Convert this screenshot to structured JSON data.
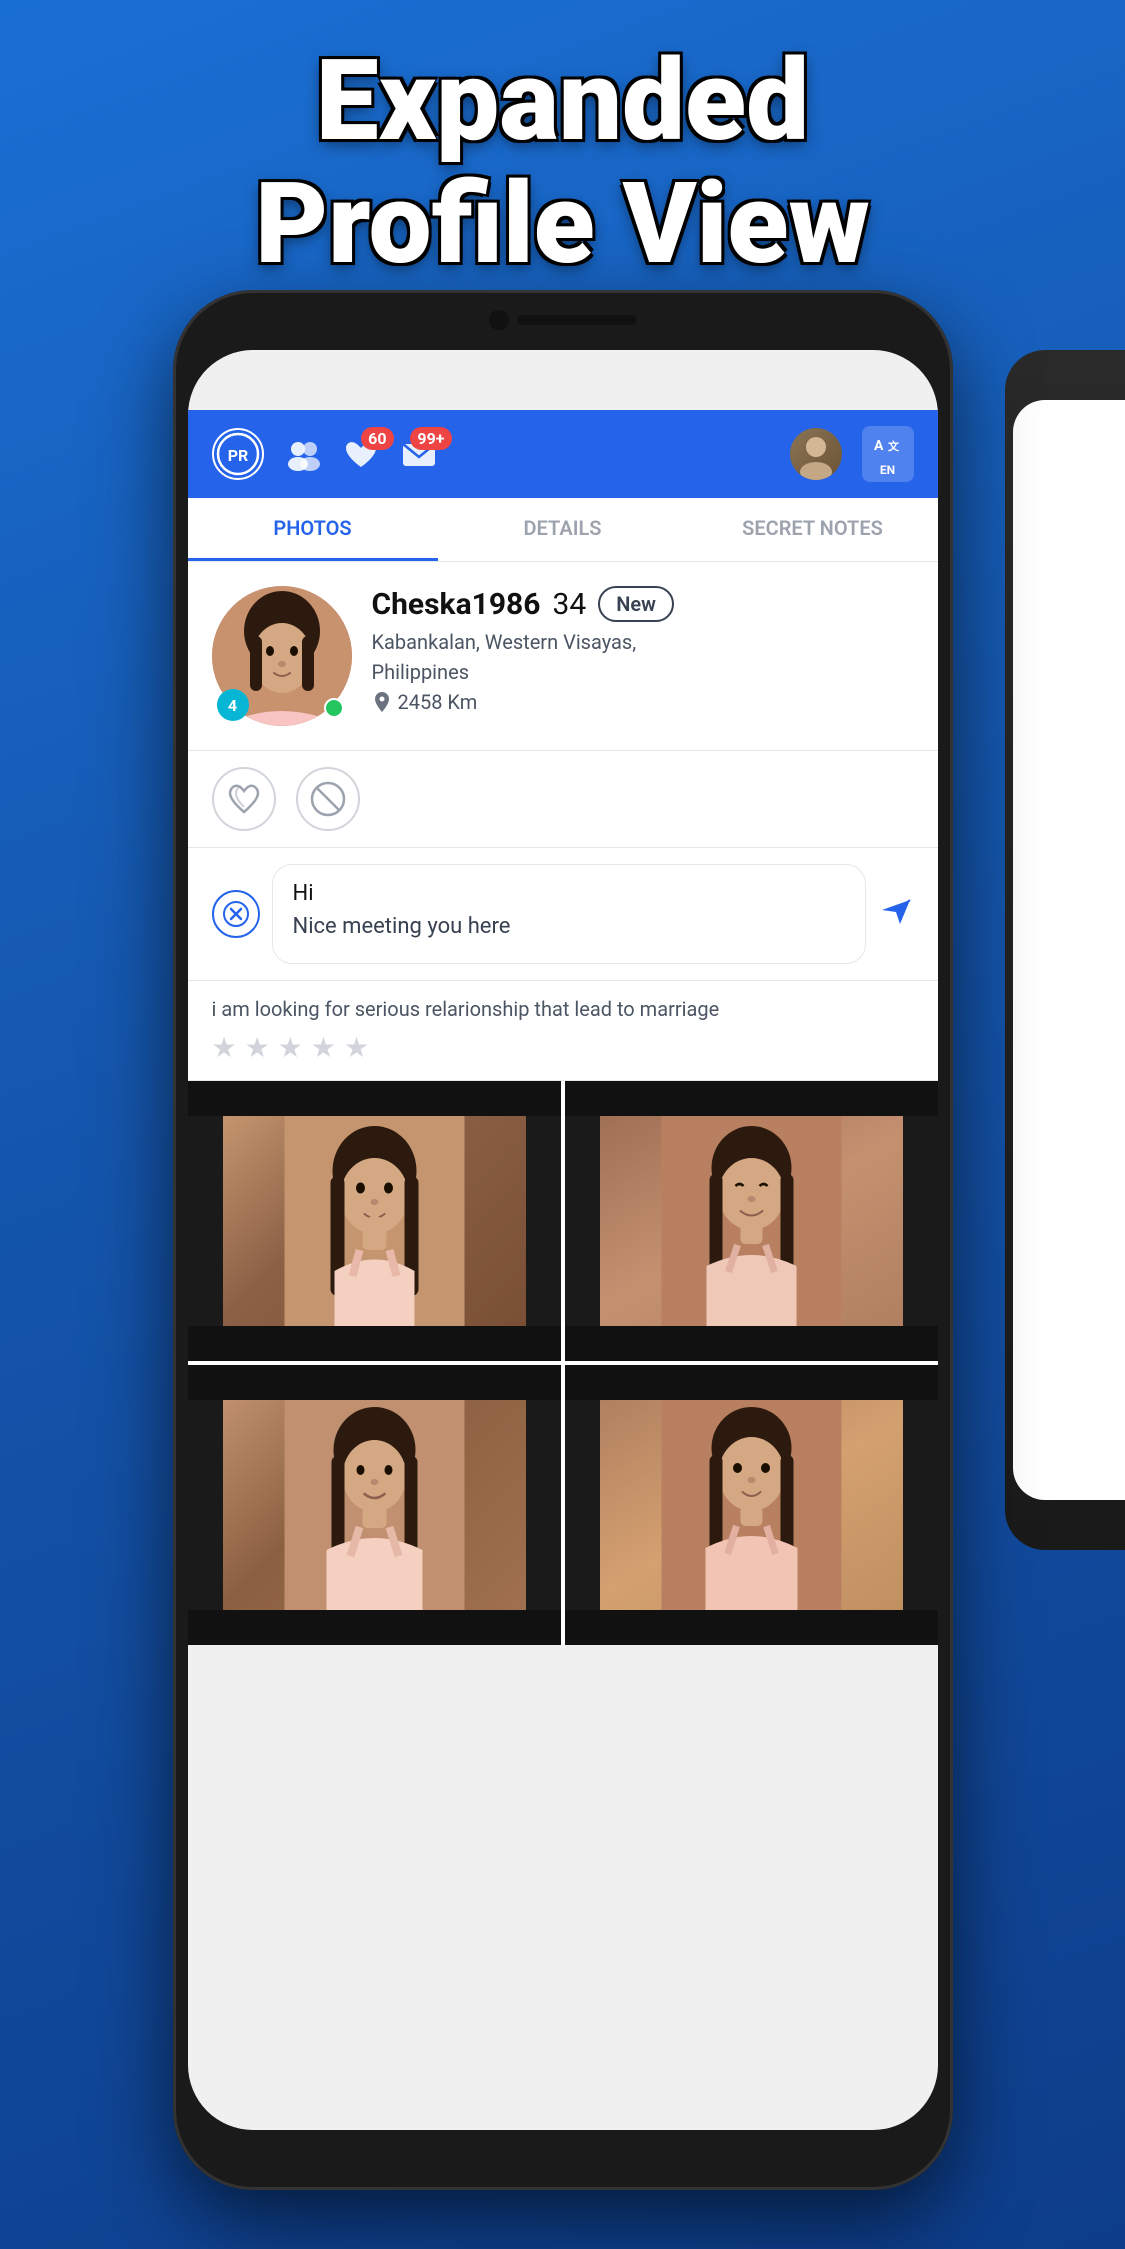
{
  "hero": {
    "title_line1": "Expanded",
    "title_line2": "Profile View"
  },
  "app": {
    "pr_label": "PR",
    "nav_badge_1": "60",
    "nav_badge_2": "99+",
    "translate_label": "A",
    "lang_label": "EN"
  },
  "tabs": {
    "items": [
      {
        "label": "PHOTOS",
        "active": true
      },
      {
        "label": "DETAILS",
        "active": false
      },
      {
        "label": "SECRET NOTES",
        "active": false
      }
    ]
  },
  "profile": {
    "name": "Cheska1986",
    "age": "34",
    "new_badge": "New",
    "location": "Kabankalan, Western Visayas,",
    "country": "Philippines",
    "distance": "2458 Km",
    "photo_count": "4",
    "bio": "i am looking for serious relarionship that lead to marriage",
    "stars": [
      "★",
      "★",
      "★",
      "★",
      "★"
    ]
  },
  "message": {
    "line1": "Hi",
    "line2": "Nice meeting you here"
  },
  "actions": {
    "like_icon": "♡♡",
    "block_icon": "⊘",
    "close_icon": "✕",
    "send_icon": "➤"
  },
  "photos": [
    {
      "id": 1,
      "label": "photo-1"
    },
    {
      "id": 2,
      "label": "photo-2"
    },
    {
      "id": 3,
      "label": "photo-3"
    },
    {
      "id": 4,
      "label": "photo-4"
    }
  ]
}
